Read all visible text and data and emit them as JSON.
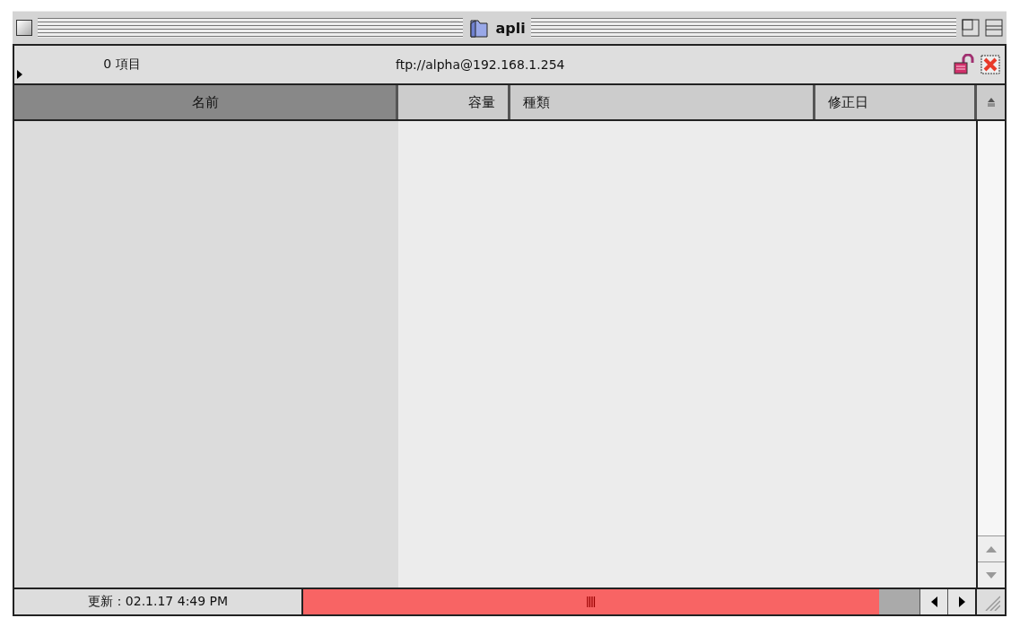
{
  "window": {
    "title": "apli"
  },
  "info_bar": {
    "expanded": false,
    "item_count": "0 項目",
    "location": "ftp://alpha@192.168.1.254"
  },
  "columns": [
    {
      "label": "名前",
      "selected": true
    },
    {
      "label": "容量",
      "selected": false
    },
    {
      "label": "種類",
      "selected": false
    },
    {
      "label": "修正日",
      "selected": false
    }
  ],
  "status_bar": {
    "updated": "更新：02.1.17 4:49 PM"
  }
}
